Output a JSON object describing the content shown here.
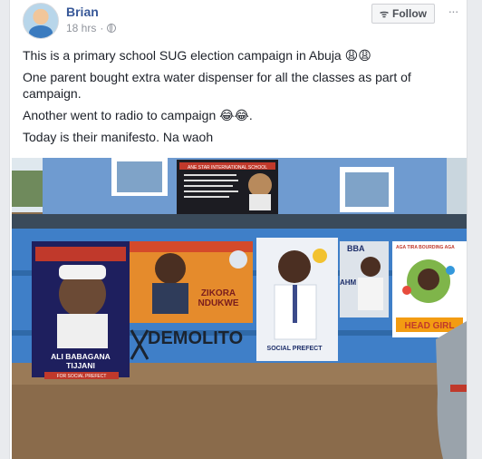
{
  "post": {
    "author": "Brian",
    "time": "18 hrs",
    "privacy_icon": "globe-icon",
    "follow_label": "Follow",
    "more_label": "···",
    "paragraphs": [
      "This is a primary school SUG election campaign in Abuja 😩😩",
      "One parent bought extra water dispenser for all the classes as part of campaign.",
      "Another went to radio to campaign 😂😂.",
      "Today is their manifesto. Na waoh"
    ]
  },
  "photo": {
    "banner": "ANE STAR INTERNATIONAL SCHOOL",
    "graffiti": "DEMOLITO",
    "posters": [
      {
        "name_line1": "ALI BABAGANA",
        "name_line2": "TIJJANI",
        "position": "FOR SOCIAL PREFECT"
      },
      {
        "name_line1": "ZIKORA",
        "name_line2": "NDUKWE"
      },
      {
        "position": "SOCIAL PREFECT"
      },
      {
        "top_text": "BBA",
        "side_text": "AHM"
      },
      {
        "top_text": "AGA TIRA BOURDING AGA",
        "position": "HEAD GIRL"
      }
    ]
  },
  "colors": {
    "link": "#385898",
    "meta": "#90949c",
    "wall": "#3f7fc8"
  }
}
